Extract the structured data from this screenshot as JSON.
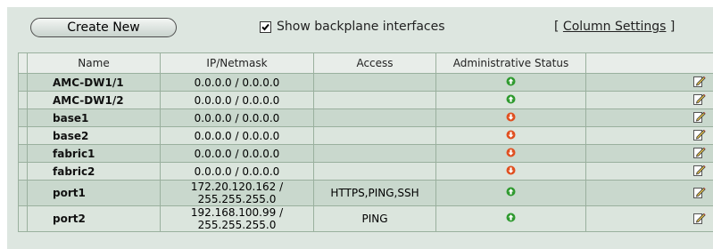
{
  "toolbar": {
    "create_label": "Create New",
    "backplane_label": "Show backplane interfaces",
    "backplane_checked": true,
    "colset_open": "[ ",
    "colset_link": "Column Settings",
    "colset_close": " ]"
  },
  "table": {
    "headers": [
      "Name",
      "IP/Netmask",
      "Access",
      "Administrative Status",
      ""
    ],
    "rows": [
      {
        "name": "AMC-DW1/1",
        "ip": "0.0.0.0 / 0.0.0.0",
        "access": "",
        "status": "up"
      },
      {
        "name": "AMC-DW1/2",
        "ip": "0.0.0.0 / 0.0.0.0",
        "access": "",
        "status": "up"
      },
      {
        "name": "base1",
        "ip": "0.0.0.0 / 0.0.0.0",
        "access": "",
        "status": "down"
      },
      {
        "name": "base2",
        "ip": "0.0.0.0 / 0.0.0.0",
        "access": "",
        "status": "down"
      },
      {
        "name": "fabric1",
        "ip": "0.0.0.0 / 0.0.0.0",
        "access": "",
        "status": "down"
      },
      {
        "name": "fabric2",
        "ip": "0.0.0.0 / 0.0.0.0",
        "access": "",
        "status": "down"
      },
      {
        "name": "port1",
        "ip": "172.20.120.162 / 255.255.255.0",
        "access": "HTTPS,PING,SSH",
        "status": "up"
      },
      {
        "name": "port2",
        "ip": "192.168.100.99 / 255.255.255.0",
        "access": "PING",
        "status": "up"
      }
    ]
  },
  "icons": {
    "status_up": "status-up-icon",
    "status_down": "status-down-icon",
    "edit": "edit-icon",
    "checkbox": "checkbox-checked-icon"
  },
  "colors": {
    "panel_bg": "#dde6e0",
    "row_even": "#c9d8cd",
    "row_odd": "#dbe5dd",
    "status_up": "#2f9a2f",
    "status_down": "#e05020"
  }
}
